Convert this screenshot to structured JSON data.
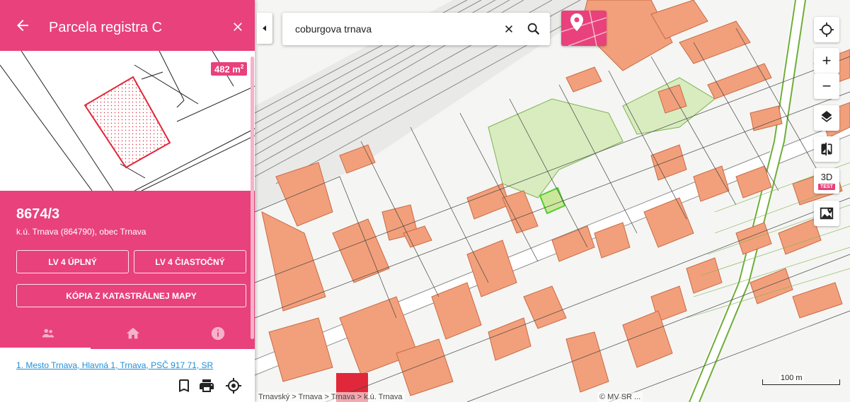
{
  "panel": {
    "title": "Parcela registra C",
    "area": "482 m",
    "area_unit_sup": "2",
    "parcel_number": "8674/3",
    "parcel_subtitle": "k.ú. Trnava (864790), obec Trnava",
    "buttons": {
      "lv4_full": "LV 4 ÚPLNÝ",
      "lv4_partial": "LV 4 ČIASTOČNÝ",
      "cadastral_copy": "KÓPIA Z KATASTRÁLNEJ MAPY"
    },
    "tabs": [
      {
        "icon": "people-icon",
        "active": true
      },
      {
        "icon": "home-icon",
        "active": false
      },
      {
        "icon": "info-icon",
        "active": false
      }
    ],
    "owner_link": "1. Mesto Trnava, Hlavná 1, Trnava, PSČ 917 71, SR",
    "bottom_icons": [
      "bookmark-icon",
      "print-icon",
      "locate-target-icon"
    ]
  },
  "search": {
    "value": "coburgova trnava"
  },
  "map": {
    "breadcrumb": "Trnavský > Trnava > Trnava > k.ú. Trnava",
    "copyright": "© MV SR ...",
    "scale_label": "100 m",
    "controls": [
      "gps-target-icon",
      "zoom-in-icon",
      "zoom-out-icon",
      "layers-icon",
      "compare-icon",
      "3d-toggle",
      "photo-map-icon"
    ],
    "zoom_in_label": "+",
    "zoom_out_label": "−",
    "three_d_label": "3D",
    "three_d_badge": "TEST"
  },
  "colors": {
    "accent": "#e8417b",
    "building": "#f2a07b",
    "greenery": "#d8ecc0",
    "link": "#1d8fd8"
  }
}
